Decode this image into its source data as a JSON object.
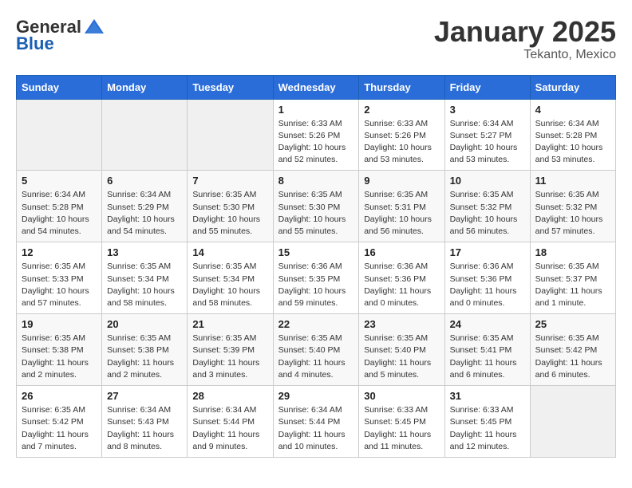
{
  "logo": {
    "general": "General",
    "blue": "Blue"
  },
  "title": {
    "month": "January 2025",
    "location": "Tekanto, Mexico"
  },
  "headers": [
    "Sunday",
    "Monday",
    "Tuesday",
    "Wednesday",
    "Thursday",
    "Friday",
    "Saturday"
  ],
  "weeks": [
    [
      {
        "day": "",
        "info": ""
      },
      {
        "day": "",
        "info": ""
      },
      {
        "day": "",
        "info": ""
      },
      {
        "day": "1",
        "info": "Sunrise: 6:33 AM\nSunset: 5:26 PM\nDaylight: 10 hours\nand 52 minutes."
      },
      {
        "day": "2",
        "info": "Sunrise: 6:33 AM\nSunset: 5:26 PM\nDaylight: 10 hours\nand 53 minutes."
      },
      {
        "day": "3",
        "info": "Sunrise: 6:34 AM\nSunset: 5:27 PM\nDaylight: 10 hours\nand 53 minutes."
      },
      {
        "day": "4",
        "info": "Sunrise: 6:34 AM\nSunset: 5:28 PM\nDaylight: 10 hours\nand 53 minutes."
      }
    ],
    [
      {
        "day": "5",
        "info": "Sunrise: 6:34 AM\nSunset: 5:28 PM\nDaylight: 10 hours\nand 54 minutes."
      },
      {
        "day": "6",
        "info": "Sunrise: 6:34 AM\nSunset: 5:29 PM\nDaylight: 10 hours\nand 54 minutes."
      },
      {
        "day": "7",
        "info": "Sunrise: 6:35 AM\nSunset: 5:30 PM\nDaylight: 10 hours\nand 55 minutes."
      },
      {
        "day": "8",
        "info": "Sunrise: 6:35 AM\nSunset: 5:30 PM\nDaylight: 10 hours\nand 55 minutes."
      },
      {
        "day": "9",
        "info": "Sunrise: 6:35 AM\nSunset: 5:31 PM\nDaylight: 10 hours\nand 56 minutes."
      },
      {
        "day": "10",
        "info": "Sunrise: 6:35 AM\nSunset: 5:32 PM\nDaylight: 10 hours\nand 56 minutes."
      },
      {
        "day": "11",
        "info": "Sunrise: 6:35 AM\nSunset: 5:32 PM\nDaylight: 10 hours\nand 57 minutes."
      }
    ],
    [
      {
        "day": "12",
        "info": "Sunrise: 6:35 AM\nSunset: 5:33 PM\nDaylight: 10 hours\nand 57 minutes."
      },
      {
        "day": "13",
        "info": "Sunrise: 6:35 AM\nSunset: 5:34 PM\nDaylight: 10 hours\nand 58 minutes."
      },
      {
        "day": "14",
        "info": "Sunrise: 6:35 AM\nSunset: 5:34 PM\nDaylight: 10 hours\nand 58 minutes."
      },
      {
        "day": "15",
        "info": "Sunrise: 6:36 AM\nSunset: 5:35 PM\nDaylight: 10 hours\nand 59 minutes."
      },
      {
        "day": "16",
        "info": "Sunrise: 6:36 AM\nSunset: 5:36 PM\nDaylight: 11 hours\nand 0 minutes."
      },
      {
        "day": "17",
        "info": "Sunrise: 6:36 AM\nSunset: 5:36 PM\nDaylight: 11 hours\nand 0 minutes."
      },
      {
        "day": "18",
        "info": "Sunrise: 6:35 AM\nSunset: 5:37 PM\nDaylight: 11 hours\nand 1 minute."
      }
    ],
    [
      {
        "day": "19",
        "info": "Sunrise: 6:35 AM\nSunset: 5:38 PM\nDaylight: 11 hours\nand 2 minutes."
      },
      {
        "day": "20",
        "info": "Sunrise: 6:35 AM\nSunset: 5:38 PM\nDaylight: 11 hours\nand 2 minutes."
      },
      {
        "day": "21",
        "info": "Sunrise: 6:35 AM\nSunset: 5:39 PM\nDaylight: 11 hours\nand 3 minutes."
      },
      {
        "day": "22",
        "info": "Sunrise: 6:35 AM\nSunset: 5:40 PM\nDaylight: 11 hours\nand 4 minutes."
      },
      {
        "day": "23",
        "info": "Sunrise: 6:35 AM\nSunset: 5:40 PM\nDaylight: 11 hours\nand 5 minutes."
      },
      {
        "day": "24",
        "info": "Sunrise: 6:35 AM\nSunset: 5:41 PM\nDaylight: 11 hours\nand 6 minutes."
      },
      {
        "day": "25",
        "info": "Sunrise: 6:35 AM\nSunset: 5:42 PM\nDaylight: 11 hours\nand 6 minutes."
      }
    ],
    [
      {
        "day": "26",
        "info": "Sunrise: 6:35 AM\nSunset: 5:42 PM\nDaylight: 11 hours\nand 7 minutes."
      },
      {
        "day": "27",
        "info": "Sunrise: 6:34 AM\nSunset: 5:43 PM\nDaylight: 11 hours\nand 8 minutes."
      },
      {
        "day": "28",
        "info": "Sunrise: 6:34 AM\nSunset: 5:44 PM\nDaylight: 11 hours\nand 9 minutes."
      },
      {
        "day": "29",
        "info": "Sunrise: 6:34 AM\nSunset: 5:44 PM\nDaylight: 11 hours\nand 10 minutes."
      },
      {
        "day": "30",
        "info": "Sunrise: 6:33 AM\nSunset: 5:45 PM\nDaylight: 11 hours\nand 11 minutes."
      },
      {
        "day": "31",
        "info": "Sunrise: 6:33 AM\nSunset: 5:45 PM\nDaylight: 11 hours\nand 12 minutes."
      },
      {
        "day": "",
        "info": ""
      }
    ]
  ]
}
